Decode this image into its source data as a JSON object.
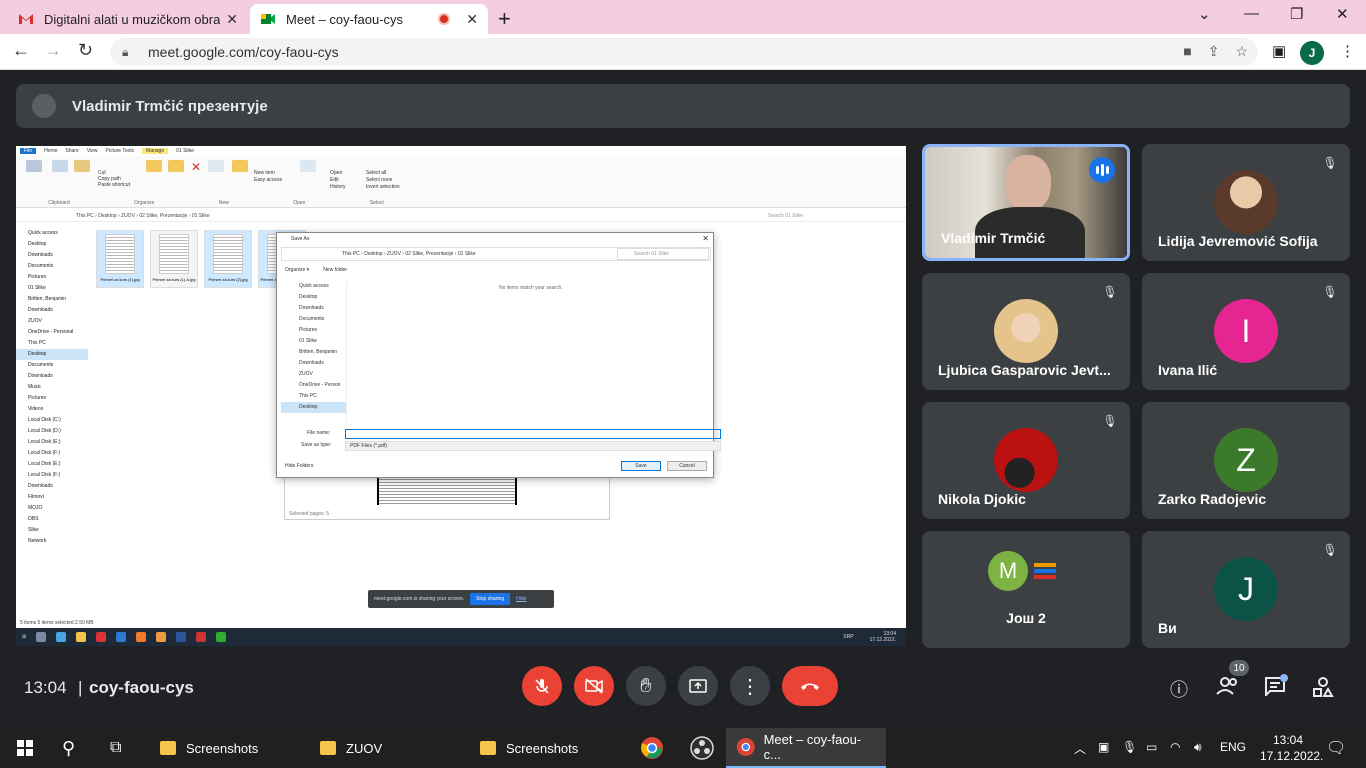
{
  "browser": {
    "tabs": [
      {
        "label": "Digitalni alati u muzičkom obrazo"
      },
      {
        "label": "Meet – coy-faou-cys"
      }
    ],
    "url": "meet.google.com/coy-faou-cys",
    "profile_initial": "J"
  },
  "meet": {
    "presenting_banner": "Vladimir Trmčić презентује",
    "time": "13:04",
    "separator": "|",
    "meeting_code": "coy-faou-cys",
    "participants_count": "10",
    "tiles": [
      {
        "name": "Vladimir Trmčić",
        "kind": "video",
        "speaking": true
      },
      {
        "name": "Lidija Jevremović Sofija",
        "kind": "photo",
        "muted": true
      },
      {
        "name": "Ljubica Gasparovic Jevt...",
        "kind": "photo",
        "muted": true
      },
      {
        "name": "Ivana Ilić",
        "kind": "initial",
        "initial": "I",
        "color": "#e52592",
        "muted": true
      },
      {
        "name": "Nikola Djokic",
        "kind": "photo",
        "muted": true
      },
      {
        "name": "Zarko Radojevic",
        "kind": "initial",
        "initial": "Z",
        "color": "#3a7a2a",
        "muted": true
      },
      {
        "name": "Још 2",
        "kind": "more",
        "initial": "M",
        "color": "#7cb342"
      },
      {
        "name": "Ви",
        "kind": "initial",
        "initial": "J",
        "color": "#0b5346",
        "muted": true
      }
    ]
  },
  "shared_screen": {
    "ribbon_tabs": [
      "File",
      "Home",
      "Share",
      "View",
      "Picture Tools",
      "Manage",
      "01 Slike"
    ],
    "ribbon_groups": [
      "Clipboard",
      "Organize",
      "New",
      "Open",
      "Select"
    ],
    "ribbon_buttons": [
      "Pin to Quick access",
      "Copy",
      "Paste",
      "Cut",
      "Copy path",
      "Paste shortcut",
      "Move to",
      "Copy to",
      "Delete",
      "Rename",
      "New folder",
      "New item",
      "Easy access",
      "Properties",
      "Open",
      "Edit",
      "History",
      "Select all",
      "Select none",
      "Invert selection"
    ],
    "address": "This PC  ›  Desktop  ›  ZUOV  ›  02 Slike, Prezentacije  ›  01 Slike",
    "search_placeholder": "Search 01 Slike",
    "nav_items": [
      "Quick access",
      "Desktop",
      "Downloads",
      "Documents",
      "Pictures",
      "01 Slike",
      "Britten, Benjamin",
      "Downloads",
      "ZUOV",
      "OneDrive - Personal",
      "This PC",
      "Desktop",
      "Documents",
      "Downloads",
      "Music",
      "Pictures",
      "Videos",
      "Local Disk (C:)",
      "Local Disk (D:)",
      "Local Disk (E:)",
      "Local Disk (F:)",
      "Local Disk (E:)",
      "Local Disk (F:)",
      "Downloads",
      "Filmovi",
      "MOJO",
      "OBS",
      "Slike",
      "Network"
    ],
    "files": [
      "Primeri za kurs (1).jpg",
      "Primeri za kurs (1).A.jpg",
      "Primeri za kurs (2).jpg",
      "Primeri za kurs (2).A.jpg"
    ],
    "status": "5 items    5 items selected  2.50 MB",
    "print_footer": "Selected pages: 5",
    "save_as": {
      "title": "Save As",
      "address": "This PC  ›  Desktop  ›  ZUOV  ›  02 Slike, Prezentacije  ›  01 Slike",
      "search": "Search 01 Slike",
      "organize": "Organize ▾",
      "new_folder": "New folder",
      "nav_items": [
        "Quick access",
        "Desktop",
        "Downloads",
        "Documents",
        "Pictures",
        "01 Slike",
        "Britten, Benjamin",
        "Downloads",
        "ZUOV",
        "OneDrive - Person",
        "This PC",
        "Desktop"
      ],
      "empty_msg": "No items match your search.",
      "file_name_label": "File name:",
      "file_name_value": "",
      "type_label": "Save as type:",
      "type_value": "PDF Files (*.pdf)",
      "hide_folders": "Hide Folders",
      "save": "Save",
      "cancel": "Cancel"
    },
    "share_bar": {
      "text": "meet.google.com is sharing your screen.",
      "stop": "Stop sharing",
      "hide": "Hide"
    },
    "inner_clock": {
      "time": "13:04",
      "date": "17.12.2022."
    },
    "inner_lang": "SRP"
  },
  "taskbar": {
    "items": [
      "Screenshots",
      "ZUOV",
      "Screenshots",
      "Meet – coy-faou-c..."
    ],
    "lang": "ENG",
    "time": "13:04",
    "date": "17.12.2022."
  }
}
